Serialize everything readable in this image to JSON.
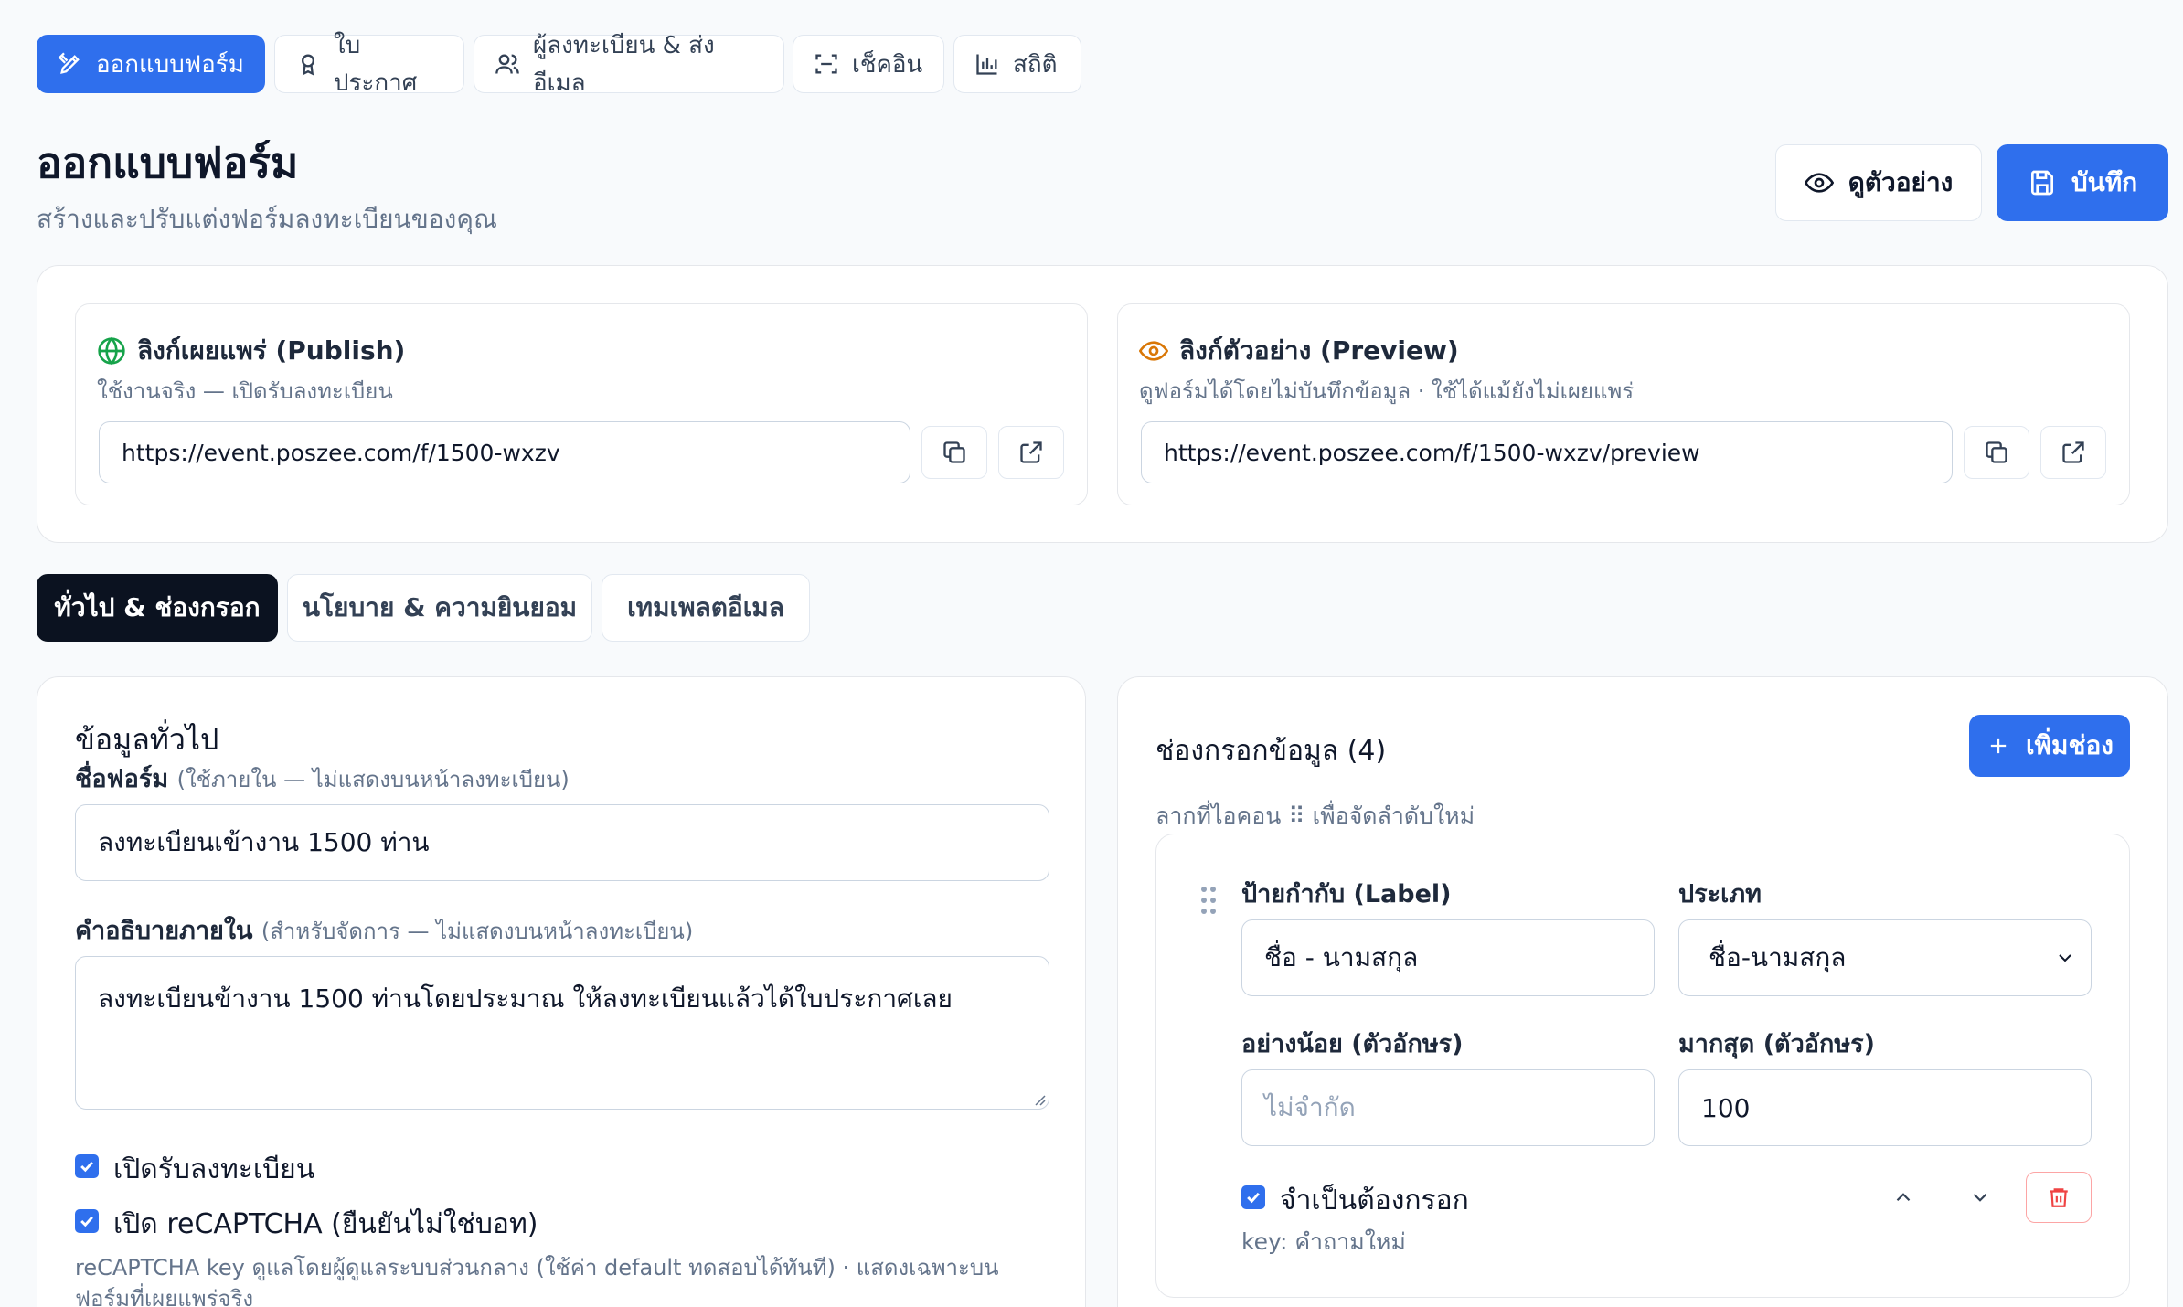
{
  "nav": {
    "tabs": [
      {
        "label": "ออกแบบฟอร์ม",
        "icon": "pencil-ruler-icon",
        "active": true
      },
      {
        "label": "ใบประกาศ",
        "icon": "award-icon"
      },
      {
        "label": "ผู้ลงทะเบียน & ส่งอีเมล",
        "icon": "users-icon"
      },
      {
        "label": "เช็คอิน",
        "icon": "scan-icon"
      },
      {
        "label": "สถิติ",
        "icon": "bar-chart-icon"
      }
    ]
  },
  "header": {
    "title": "ออกแบบฟอร์ม",
    "subtitle": "สร้างและปรับแต่งฟอร์มลงทะเบียนของคุณ",
    "preview_label": "ดูตัวอย่าง",
    "save_label": "บันทึก"
  },
  "links": {
    "publish": {
      "title": "ลิงก์เผยแพร่ (Publish)",
      "subtitle": "ใช้งานจริง — เปิดรับลงทะเบียน",
      "url": "https://event.poszee.com/f/1500-wxzv"
    },
    "preview": {
      "title": "ลิงก์ตัวอย่าง (Preview)",
      "subtitle": "ดูฟอร์มได้โดยไม่บันทึกข้อมูล · ใช้ได้แม้ยังไม่เผยแพร่",
      "url": "https://event.poszee.com/f/1500-wxzv/preview"
    }
  },
  "form_tabs": [
    {
      "label": "ทั่วไป & ช่องกรอก",
      "active": true
    },
    {
      "label": "นโยบาย & ความยินยอม"
    },
    {
      "label": "เทมเพลตอีเมล"
    }
  ],
  "general": {
    "section_title": "ข้อมูลทั่วไป",
    "form_name_label": "ชื่อฟอร์ม",
    "form_name_hint": "(ใช้ภายใน — ไม่แสดงบนหน้าลงทะเบียน)",
    "form_name_value": "ลงทะเบียนเข้างาน 1500 ท่าน",
    "desc_label": "คำอธิบายภายใน",
    "desc_hint": "(สำหรับจัดการ — ไม่แสดงบนหน้าลงทะเบียน)",
    "desc_value": "ลงทะเบียนข้างาน 1500 ท่านโดยประมาณ ให้ลงทะเบียนแล้วได้ใบประกาศเลย",
    "open_registration_label": "เปิดรับลงทะเบียน",
    "open_registration_checked": true,
    "recaptcha_label": "เปิด reCAPTCHA (ยืนยันไม่ใช่บอท)",
    "recaptcha_checked": true,
    "recaptcha_note": "reCAPTCHA key ดูแลโดยผู้ดูแลระบบส่วนกลาง (ใช้ค่า default ทดสอบได้ทันที) · แสดงเฉพาะบนฟอร์มที่เผยแพร่จริง"
  },
  "fields": {
    "title": "ช่องกรอกข้อมูล (4)",
    "add_label": "เพิ่มช่อง",
    "drag_hint": "ลากที่ไอคอน ⠿ เพื่อจัดลำดับใหม่",
    "item": {
      "label_label": "ป้ายกำกับ (Label)",
      "label_value": "ชื่อ - นามสกุล",
      "type_label": "ประเภท",
      "type_value": "ชื่อ-นามสกุล",
      "min_label": "อย่างน้อย (ตัวอักษร)",
      "min_placeholder": "ไม่จำกัด",
      "max_label": "มากสุด (ตัวอักษร)",
      "max_value": "100",
      "required_label": "จำเป็นต้องกรอก",
      "required_checked": true,
      "key_text": "key: คำถามใหม่"
    }
  },
  "colors": {
    "primary": "#2f6fed",
    "dark": "#0b1220",
    "publish_icon": "#16a34a",
    "preview_icon": "#d97706",
    "danger": "#ef4444"
  }
}
